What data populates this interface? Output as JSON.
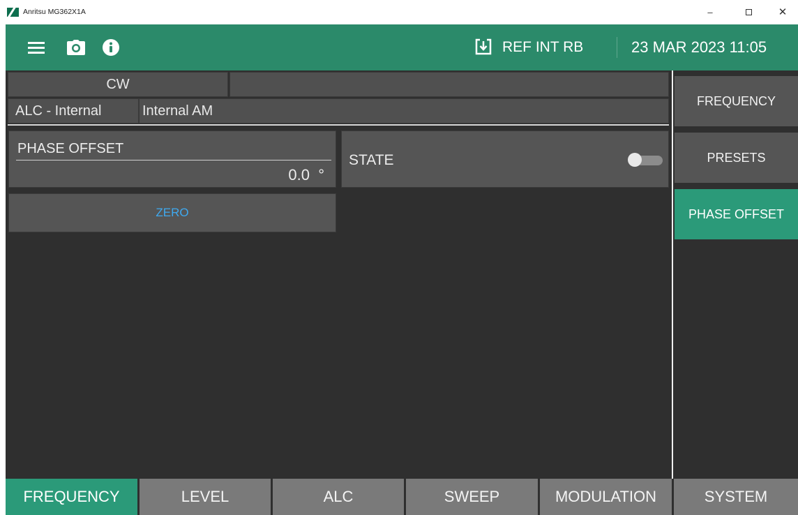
{
  "window": {
    "title": "Anritsu MG362X1A",
    "minimize": "–",
    "close": "✕"
  },
  "toolbar": {
    "ref_text": "REF INT RB",
    "datetime": "23 MAR 2023 11:05",
    "icons": [
      "menu-icon",
      "camera-icon",
      "info-icon",
      "download-icon"
    ],
    "bg_color": "#2b8a6a"
  },
  "status": {
    "mode": "CW",
    "alc_mode": "ALC - Internal",
    "modulation": "Internal AM"
  },
  "phase_offset": {
    "label": "PHASE OFFSET",
    "value": "0.0",
    "unit": "°"
  },
  "state": {
    "label": "STATE",
    "on": false
  },
  "zero_button": {
    "label": "ZERO",
    "color": "#3fa9ef"
  },
  "side_menu": {
    "items": [
      {
        "label": "FREQUENCY",
        "active": false
      },
      {
        "label": "PRESETS",
        "active": false
      },
      {
        "label": "PHASE OFFSET",
        "active": true
      }
    ],
    "active_color": "#2b9a79"
  },
  "tabs": [
    {
      "label": "FREQUENCY",
      "active": true
    },
    {
      "label": "LEVEL",
      "active": false
    },
    {
      "label": "ALC",
      "active": false
    },
    {
      "label": "SWEEP",
      "active": false
    },
    {
      "label": "MODULATION",
      "active": false
    },
    {
      "label": "SYSTEM",
      "active": false
    }
  ]
}
